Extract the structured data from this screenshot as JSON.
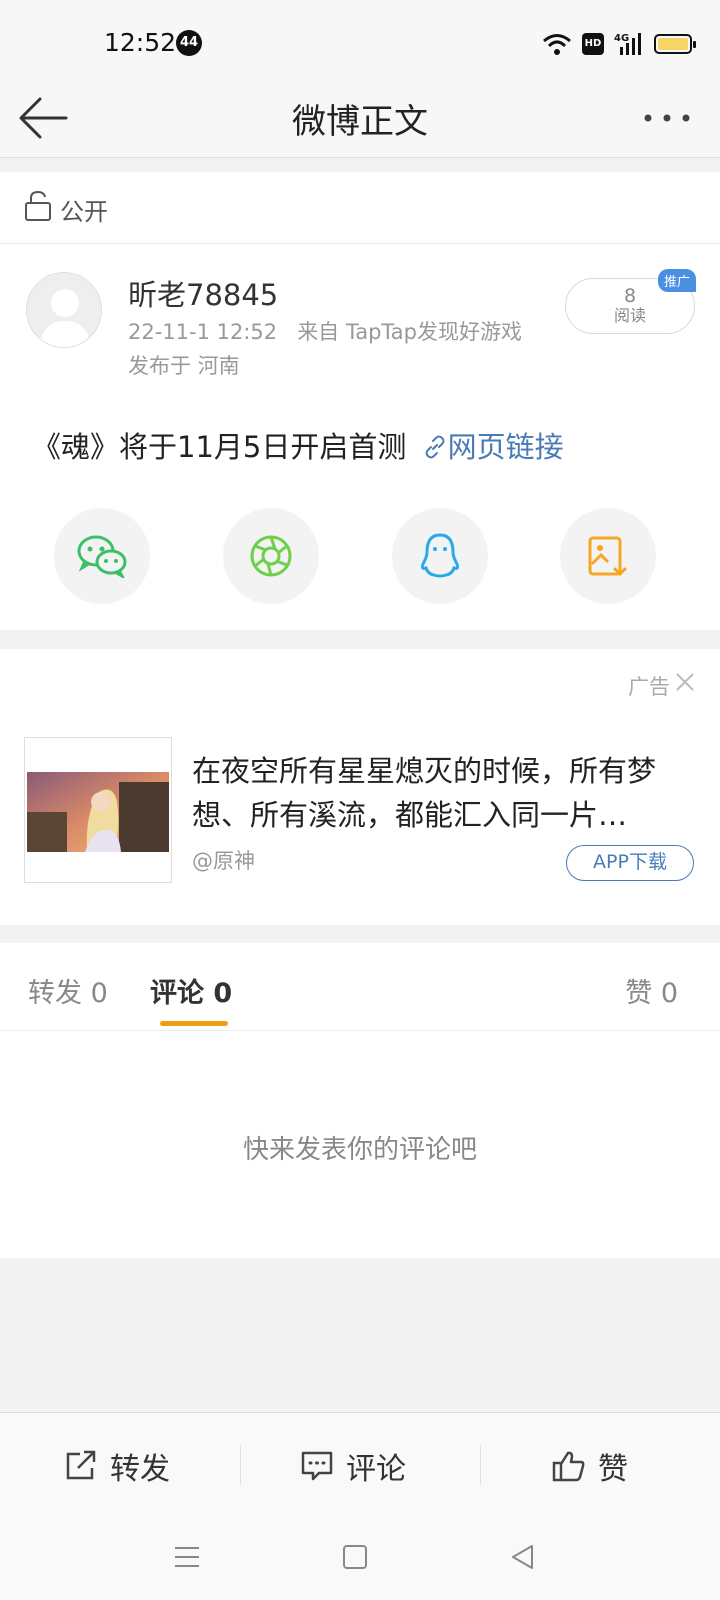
{
  "status_bar": {
    "time": "12:52",
    "notification_count": "44",
    "network": "4G",
    "hd": "HD"
  },
  "nav": {
    "title": "微博正文"
  },
  "privacy": {
    "label": "公开"
  },
  "post": {
    "username": "昕老78845",
    "timestamp": "22-11-1 12:52",
    "source": "来自 TapTap发现好游戏",
    "location": "发布于 河南",
    "read_count": "8",
    "read_label": "阅读",
    "promo_badge": "推广",
    "text": "《魂》将于11月5日开启首测",
    "link_text": "网页链接"
  },
  "share_icons": [
    {
      "name": "wechat-icon",
      "color": "#3cbf66"
    },
    {
      "name": "moments-icon",
      "color": "#6dcf4a"
    },
    {
      "name": "qq-icon",
      "color": "#2aa9e8"
    },
    {
      "name": "save-image-icon",
      "color": "#f5a623"
    }
  ],
  "ad": {
    "tag": "广告",
    "text": "在夜空所有星星熄灭的时候，所有梦想、所有溪流，都能汇入同一片…",
    "source": "@原神",
    "download_label": "APP下载"
  },
  "tabs": [
    {
      "label": "转发 0",
      "active": false
    },
    {
      "label": "评论 0",
      "active": true
    },
    {
      "label": "赞 0",
      "active": false
    }
  ],
  "comments": {
    "empty_text": "快来发表你的评论吧"
  },
  "actions": {
    "repost_label": "转发",
    "comment_label": "评论",
    "like_label": "赞"
  },
  "colors": {
    "accent": "#f39c12",
    "link": "#4a7bb7",
    "promo": "#4a90e2"
  }
}
